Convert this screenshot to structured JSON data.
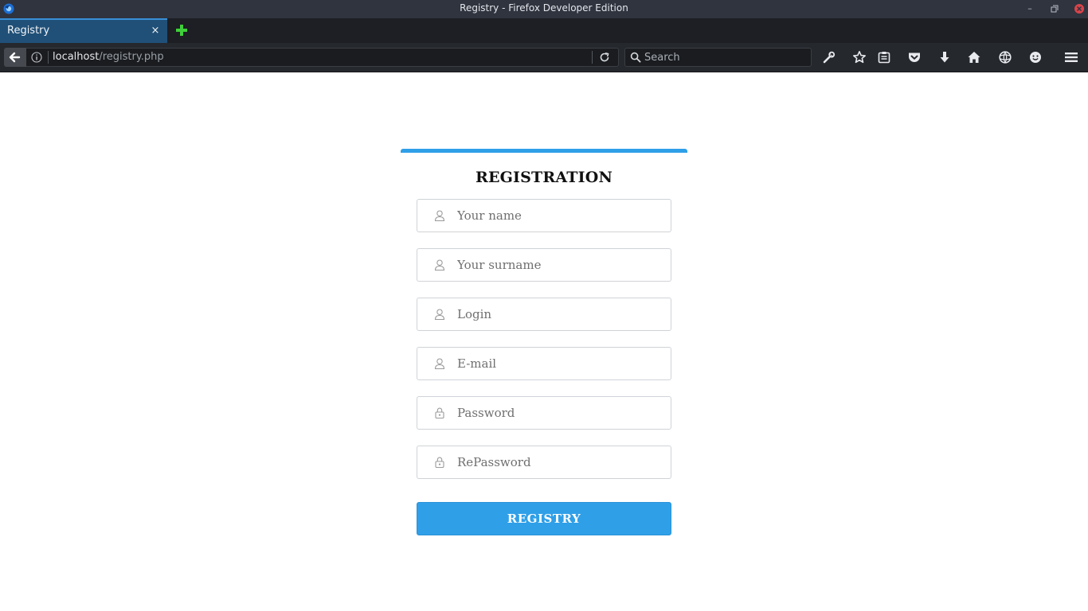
{
  "window": {
    "title": "Registry - Firefox Developer Edition",
    "controls": {
      "minimize": "–",
      "maximize": "▫",
      "close": "×"
    }
  },
  "tabs": [
    {
      "label": "Registry",
      "close": "×",
      "active": true
    }
  ],
  "toolbar": {
    "url_host": "localhost",
    "url_path": "/registry.php",
    "search_placeholder": "Search",
    "icons": [
      "back-arrow-icon",
      "info-icon",
      "reload-icon",
      "search-icon",
      "wrench-icon",
      "star-icon",
      "reading-list-icon",
      "pocket-icon",
      "download-icon",
      "home-icon",
      "globe-icon",
      "smiley-icon",
      "hamburger-menu-icon"
    ]
  },
  "form": {
    "title": "REGISTRATION",
    "fields": [
      {
        "placeholder": "Your name",
        "icon": "user-icon",
        "type": "text"
      },
      {
        "placeholder": "Your surname",
        "icon": "user-icon",
        "type": "text"
      },
      {
        "placeholder": "Login",
        "icon": "user-icon",
        "type": "text"
      },
      {
        "placeholder": "E-mail",
        "icon": "user-icon",
        "type": "email"
      },
      {
        "placeholder": "Password",
        "icon": "lock-icon",
        "type": "password"
      },
      {
        "placeholder": "RePassword",
        "icon": "lock-icon",
        "type": "password"
      }
    ],
    "submit_label": "REGISTRY"
  },
  "colors": {
    "accent": "#2f9fe8",
    "titlebar": "#2f343f",
    "tab_active": "#205078",
    "toolbar": "#25282d"
  }
}
